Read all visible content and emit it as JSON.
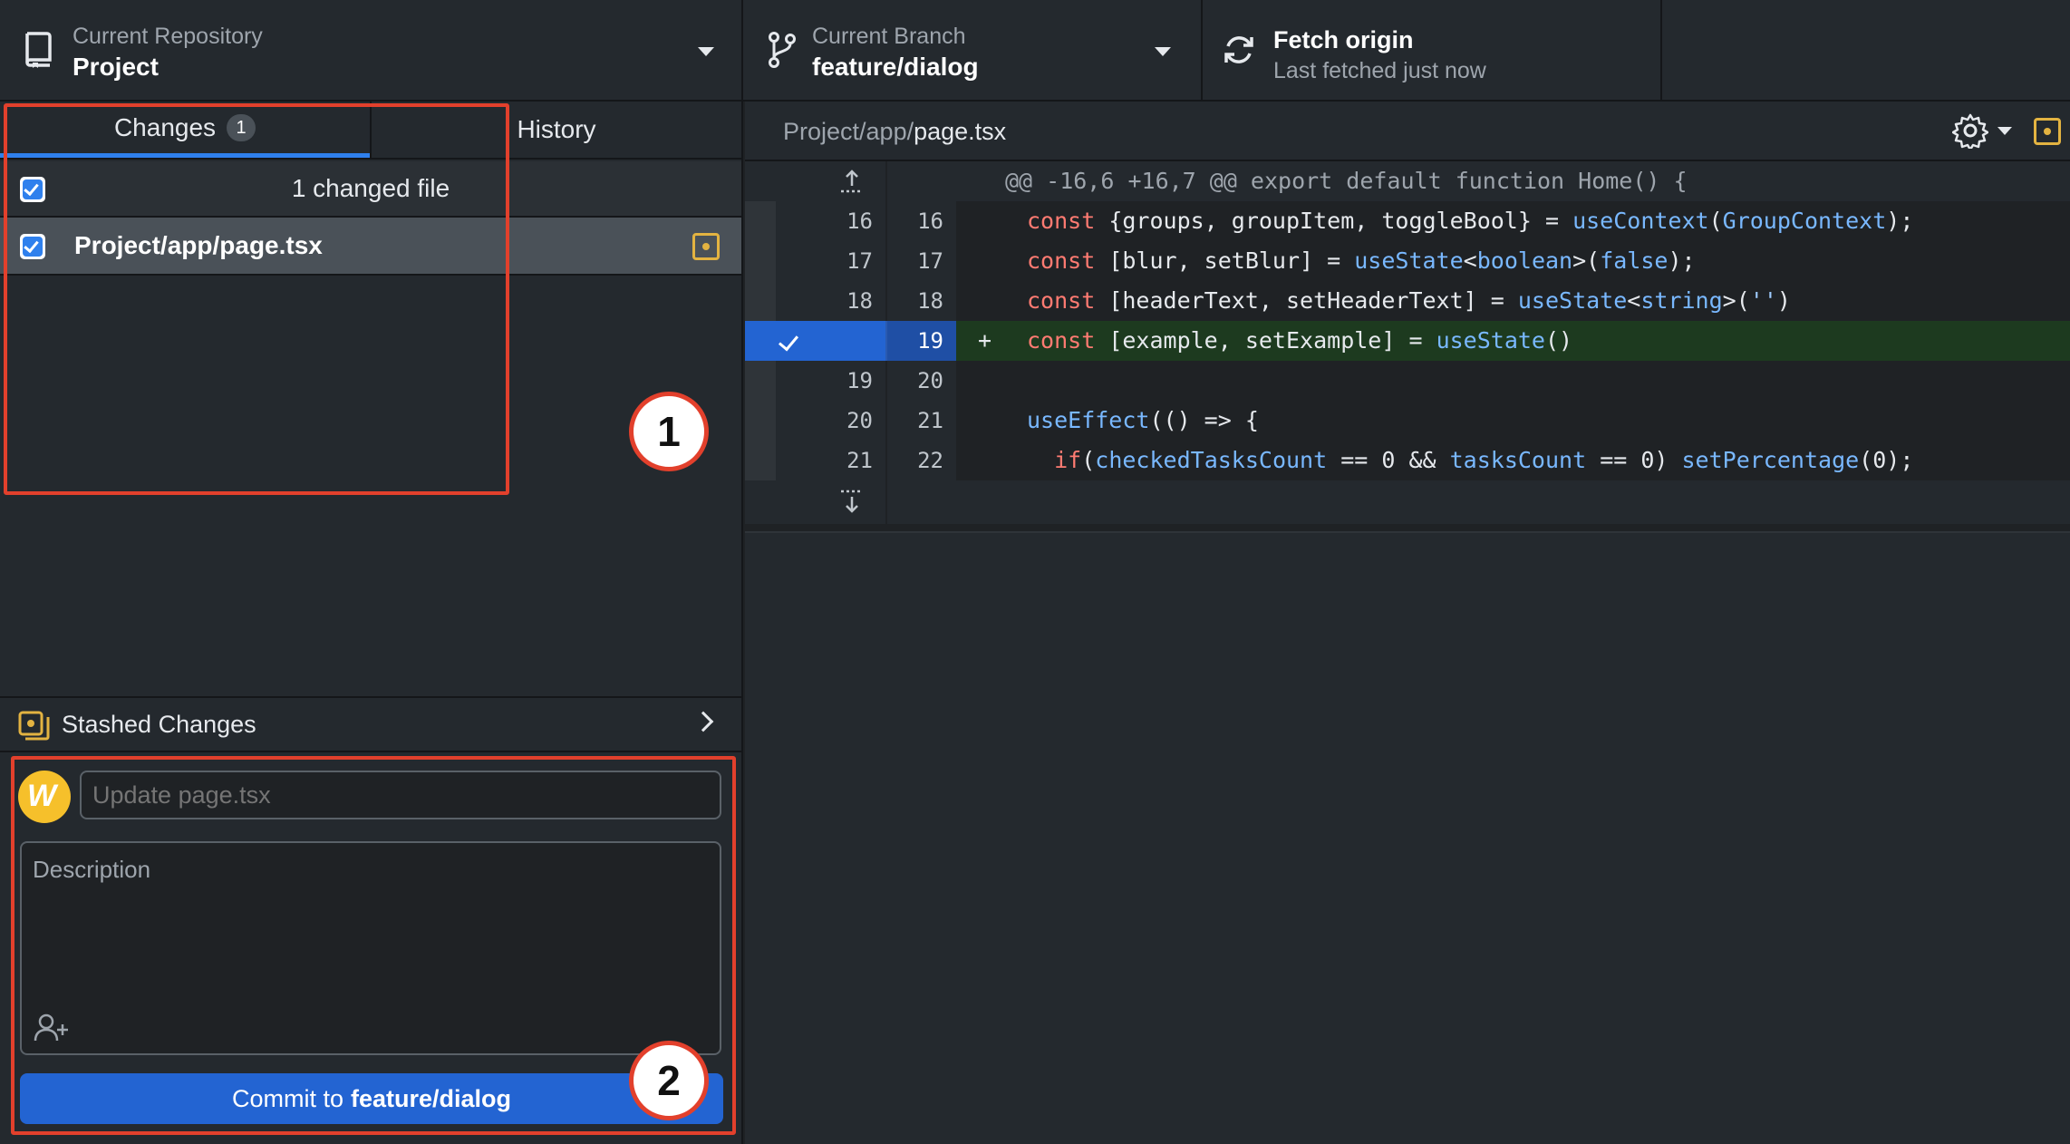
{
  "toolbar": {
    "repository": {
      "caption": "Current Repository",
      "value": "Project"
    },
    "branch": {
      "caption": "Current Branch",
      "value": "feature/dialog"
    },
    "fetch": {
      "title": "Fetch origin",
      "subtitle": "Last fetched just now"
    }
  },
  "sidebar": {
    "tabs": [
      {
        "label": "Changes",
        "badge": "1"
      },
      {
        "label": "History"
      }
    ],
    "changed_header": "1 changed file",
    "files": [
      {
        "path": "Project/app/page.tsx",
        "status": "modified"
      }
    ],
    "stash_label": "Stashed Changes"
  },
  "commit": {
    "summary_placeholder": "Update page.tsx",
    "description_placeholder": "Description",
    "button_prefix": "Commit to",
    "button_branch": "feature/dialog"
  },
  "annotations": [
    "1",
    "2"
  ],
  "diff": {
    "path_dir": "Project/app/",
    "path_file": "page.tsx",
    "hunk_header": "@@ -16,6 +16,7 @@ export default function Home() {",
    "lines": [
      {
        "old": "16",
        "new": "16",
        "type": "ctx"
      },
      {
        "old": "17",
        "new": "17",
        "type": "ctx"
      },
      {
        "old": "18",
        "new": "18",
        "type": "ctx"
      },
      {
        "old": "",
        "new": "19",
        "type": "add",
        "marker": "+"
      },
      {
        "old": "19",
        "new": "20",
        "type": "ctx"
      },
      {
        "old": "20",
        "new": "21",
        "type": "ctx"
      },
      {
        "old": "21",
        "new": "22",
        "type": "ctx"
      }
    ],
    "code_tokens": {
      "l16": [
        "const",
        " {groups, groupItem, toggleBool} = ",
        "useContext",
        "(",
        "GroupContext",
        ");"
      ],
      "l17": [
        "const",
        " [blur, setBlur] = ",
        "useState",
        "<",
        "boolean",
        ">(",
        "false",
        ");"
      ],
      "l18": [
        "const",
        " [headerText, setHeaderText] = ",
        "useState",
        "<",
        "string",
        ">(",
        "''",
        ")"
      ],
      "l19": [
        "const",
        " [example, setExample] = ",
        "useState",
        "()"
      ],
      "l21": [
        "useEffect",
        "(() => {"
      ],
      "l22": [
        "if",
        "(",
        "checkedTasksCount",
        " == 0 && ",
        "tasksCount",
        " == 0) ",
        "setPercentage",
        "(0);"
      ]
    }
  },
  "colors": {
    "accent": "#2364d2",
    "annotation": "#e2402c",
    "modified": "#e3b341",
    "added_bg": "#1d3a1f"
  }
}
